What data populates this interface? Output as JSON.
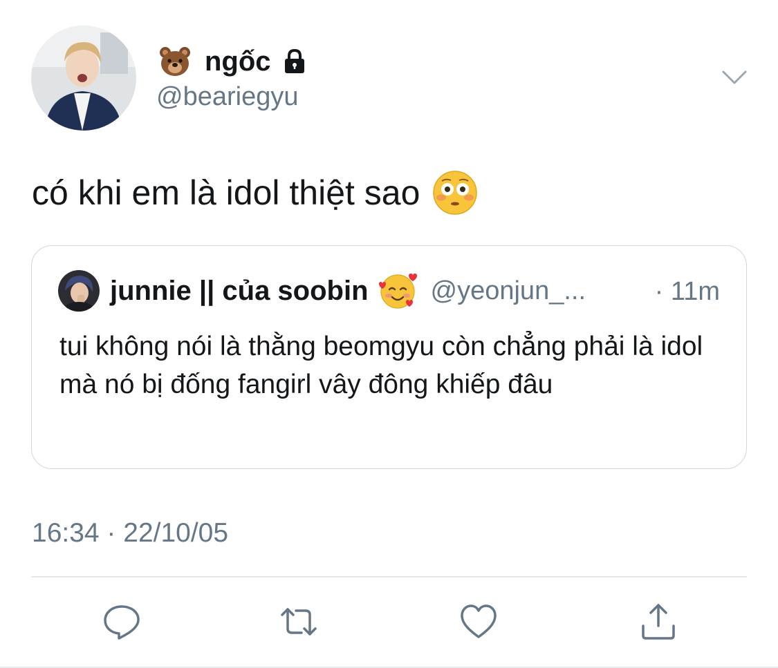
{
  "author": {
    "display_name": "ngốc",
    "name_emoji_icon": "bear-face-icon",
    "protected_icon": "lock-icon",
    "handle": "@beariegyu"
  },
  "tweet": {
    "text": "có khi em là idol thiệt sao",
    "emoji_icon": "flushed-face-icon",
    "timestamp": "16:34 · 22/10/05"
  },
  "quote": {
    "display_name": "junnie || của soobin",
    "name_emoji_icon": "smiling-face-with-hearts-icon",
    "handle": "@yeonjun_...",
    "time": "· 11m",
    "text": "tui không nói là thằng beomgyu còn chẳng phải là idol mà nó bị đống fangirl vây đông khiếp đâu"
  },
  "actions": [
    "reply-icon",
    "retweet-icon",
    "like-icon",
    "share-icon"
  ],
  "colors": {
    "text_primary": "#14171a",
    "text_secondary": "#657786",
    "border": "#cfd9de",
    "divider": "#e1e8ed",
    "icon": "#657786"
  }
}
